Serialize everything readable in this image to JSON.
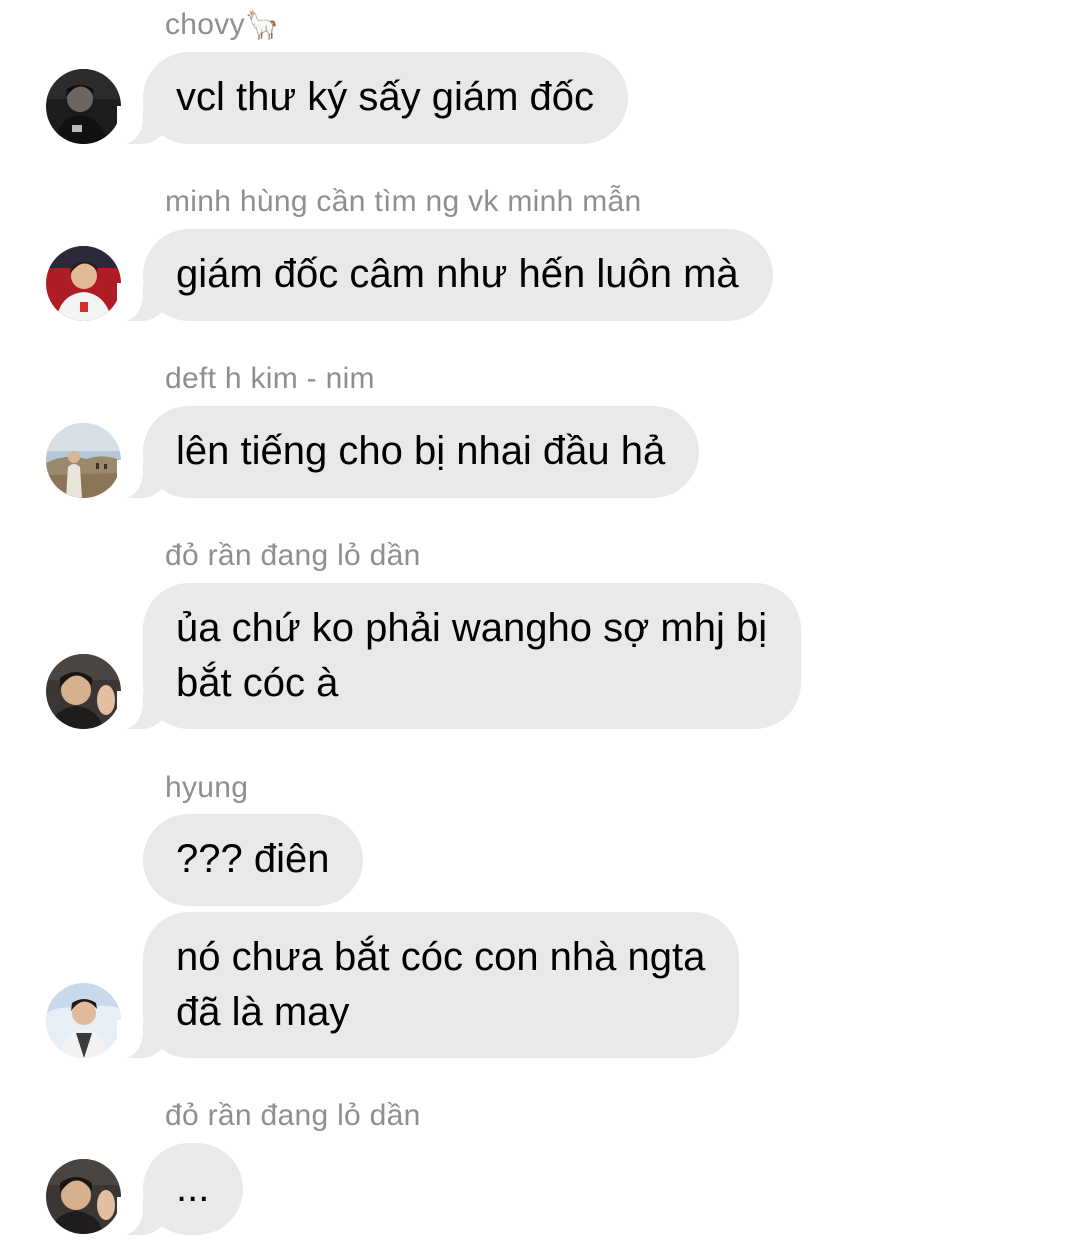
{
  "messages": [
    {
      "sender": "chovy",
      "sender_emoji": "🦙",
      "text": "vcl thư ký sấy giám đốc",
      "avatar": "avatar-chovy"
    },
    {
      "sender": "minh hùng cần tìm ng vk minh mẫn",
      "text": "giám đốc câm như hến luôn mà",
      "avatar": "avatar-minh-hung"
    },
    {
      "sender": "deft h kim - nim",
      "text": "lên tiếng cho bị nhai đầu hả",
      "avatar": "avatar-deft"
    },
    {
      "sender": "đỏ rần đang lỏ dần",
      "text": "ủa chứ ko phải wangho sợ mhj bị\nbắt cóc à",
      "avatar": "avatar-do-ran"
    },
    {
      "sender": "hyung",
      "text": "??? điên",
      "avatar": null
    },
    {
      "sender": null,
      "text": "nó chưa bắt cóc con nhà ngta\nđã là may",
      "avatar": "avatar-hyung"
    },
    {
      "sender": "đỏ rần đang lỏ dần",
      "text": "...",
      "avatar": "avatar-do-ran"
    }
  ],
  "colors": {
    "bubble_bg": "#e9e9eb",
    "sender_text": "#8e8e93",
    "message_text": "#000000"
  }
}
